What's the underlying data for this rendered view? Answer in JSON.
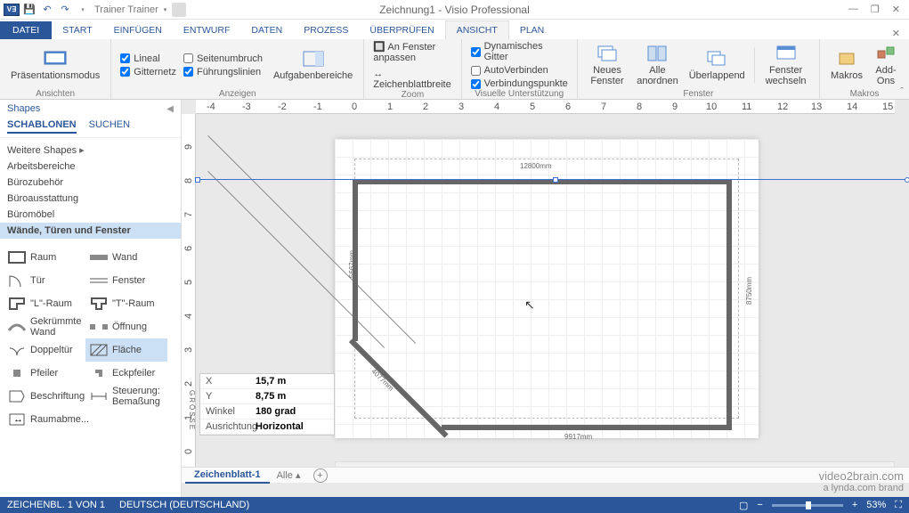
{
  "title": "Zeichnung1 - Visio Professional",
  "user": "Trainer Trainer",
  "tabs": {
    "file": "DATEI",
    "start": "START",
    "einfugen": "EINFÜGEN",
    "entwurf": "ENTWURF",
    "daten": "DATEN",
    "prozess": "PROZESS",
    "uberprufen": "ÜBERPRÜFEN",
    "ansicht": "ANSICHT",
    "plan": "PLAN"
  },
  "ribbon": {
    "group1": {
      "btn": "Präsentationsmodus",
      "label": "Ansichten"
    },
    "group2": {
      "lineal": "Lineal",
      "seitenumbruch": "Seitenumbruch",
      "gitternetz": "Gitternetz",
      "fuhrungslinien": "Führungslinien",
      "aufgaben": "Aufgabenbereiche",
      "label": "Anzeigen"
    },
    "group3": {
      "fenster": "An Fenster anpassen",
      "blatt": "Zeichenblattbreite",
      "label": "Zoom"
    },
    "group4": {
      "dyn": "Dynamisches Gitter",
      "auto": "AutoVerbinden",
      "verb": "Verbindungspunkte",
      "label": "Visuelle Unterstützung"
    },
    "group5": {
      "neues": "Neues Fenster",
      "alle": "Alle anordnen",
      "uber": "Überlappend",
      "wechseln": "Fenster wechseln",
      "label": "Fenster"
    },
    "group6": {
      "makros": "Makros",
      "addons": "Add-Ons",
      "label": "Makros"
    }
  },
  "shapes": {
    "title": "Shapes",
    "tab_schablonen": "SCHABLONEN",
    "tab_suchen": "SUCHEN",
    "cats": {
      "weitere": "Weitere Shapes",
      "arbeits": "Arbeitsbereiche",
      "buro": "Bürozubehör",
      "ausstatt": "Büroausstattung",
      "mobel": "Büromöbel",
      "wande": "Wände, Türen und Fenster"
    },
    "items": {
      "raum": "Raum",
      "wand": "Wand",
      "tur": "Tür",
      "fenster": "Fenster",
      "lraum": "\"L\"-Raum",
      "traum": "\"T\"-Raum",
      "gekr": "Gekrümmte Wand",
      "offnung": "Öffnung",
      "doppel": "Doppeltür",
      "flache": "Fläche",
      "pfeiler": "Pfeiler",
      "eck": "Eckpfeiler",
      "beschr": "Beschriftung",
      "steuer": "Steuerung: Bemaßung",
      "raumab": "Raumabme..."
    }
  },
  "props": {
    "x_k": "X",
    "x_v": "15,7 m",
    "y_k": "Y",
    "y_v": "8,75 m",
    "w_k": "Winkel",
    "w_v": "180 grad",
    "a_k": "Ausrichtung",
    "a_v": "Horizontal",
    "side": "GRÖSSE"
  },
  "dims": {
    "top": "12800mm",
    "right": "8750mm",
    "bottom": "9917mm",
    "diag": "4077mm",
    "left": "5667mm"
  },
  "sheet": {
    "name": "Zeichenblatt-1",
    "all": "Alle"
  },
  "status": {
    "page": "ZEICHENBL. 1 VON 1",
    "lang": "DEUTSCH (DEUTSCHLAND)",
    "zoom": "53%"
  },
  "watermark": {
    "l1": "video2brain.com",
    "l2": "a lynda.com brand"
  }
}
